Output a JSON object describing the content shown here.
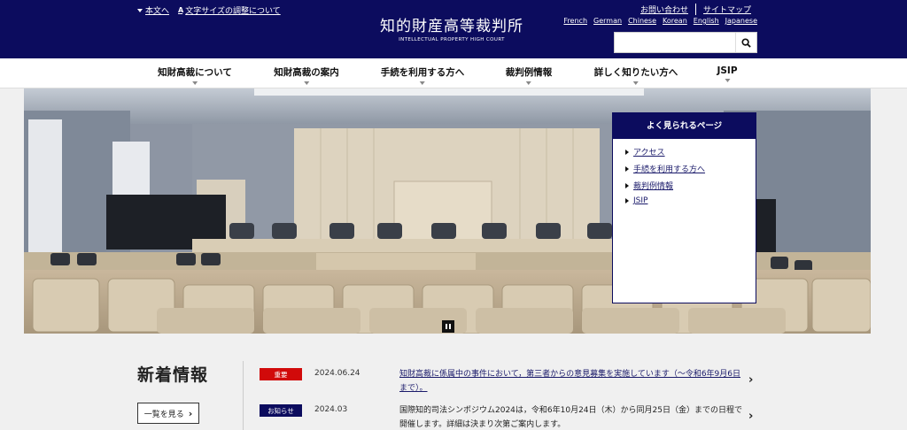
{
  "header": {
    "skip_to_content": "本文へ",
    "font_icon": "A",
    "font_size_label": "文字サイズの調整について",
    "logo_jp": "知的財産高等裁判所",
    "logo_en": "INTELLECTUAL PROPERTY HIGH COURT",
    "util_links": [
      "お問い合わせ",
      "サイトマップ"
    ],
    "languages": [
      "French",
      "German",
      "Chinese",
      "Korean",
      "English",
      "Japanese"
    ],
    "search_placeholder": ""
  },
  "nav": {
    "items": [
      "知財高裁について",
      "知財高裁の案内",
      "手続を利用する方へ",
      "裁判例情報",
      "詳しく知りたい方へ",
      "JSIP"
    ]
  },
  "popular": {
    "title": "よく見られるページ",
    "items": [
      "アクセス",
      "手続を利用する方へ",
      "裁判例情報",
      "JSIP"
    ]
  },
  "news": {
    "title": "新着情報",
    "more_label": "一覧を見る",
    "items": [
      {
        "badge": "重要",
        "date": "2024.06.24",
        "text": "知財高裁に係属中の事件において，第三者からの意見募集を実施しています（～令和6年9月6日まで）。",
        "linked": true
      },
      {
        "badge": "お知らせ",
        "date": "2024.03",
        "text": "国際知的司法シンポジウム2024は，令和6年10月24日（木）から同月25日（金）までの日程で開催します。詳細は決まり次第ご案内します。",
        "linked": false
      }
    ]
  },
  "colors": {
    "navy": "#0c0c5e",
    "important": "#d10a0a"
  }
}
